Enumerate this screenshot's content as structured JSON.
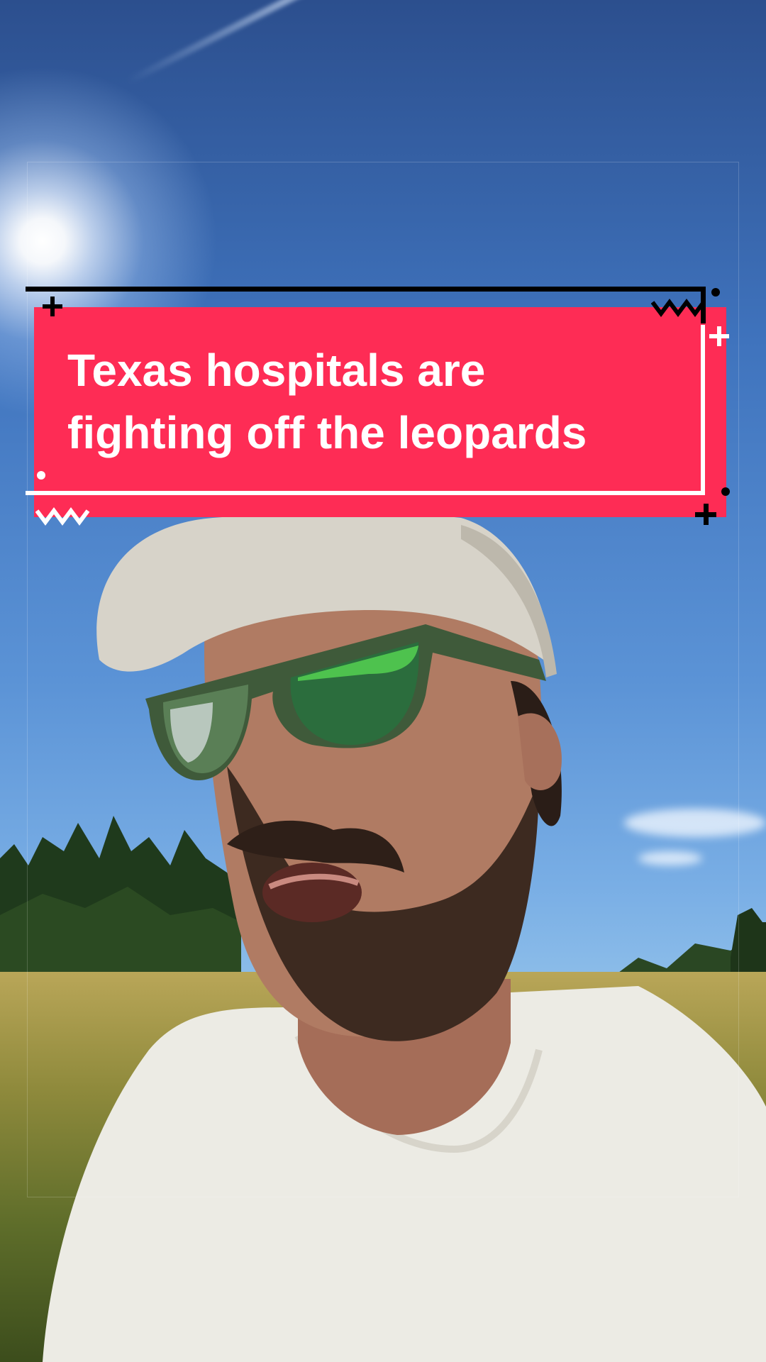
{
  "caption": {
    "line1": "Texas hospitals are",
    "line2": "fighting off the leopards"
  },
  "colors": {
    "banner": "#fe2c55",
    "caption_text": "#ffffff",
    "frame_dark": "#000000",
    "frame_light": "#ffffff"
  },
  "icons": [
    "plus-icon",
    "zigzag-icon",
    "dot-icon"
  ]
}
